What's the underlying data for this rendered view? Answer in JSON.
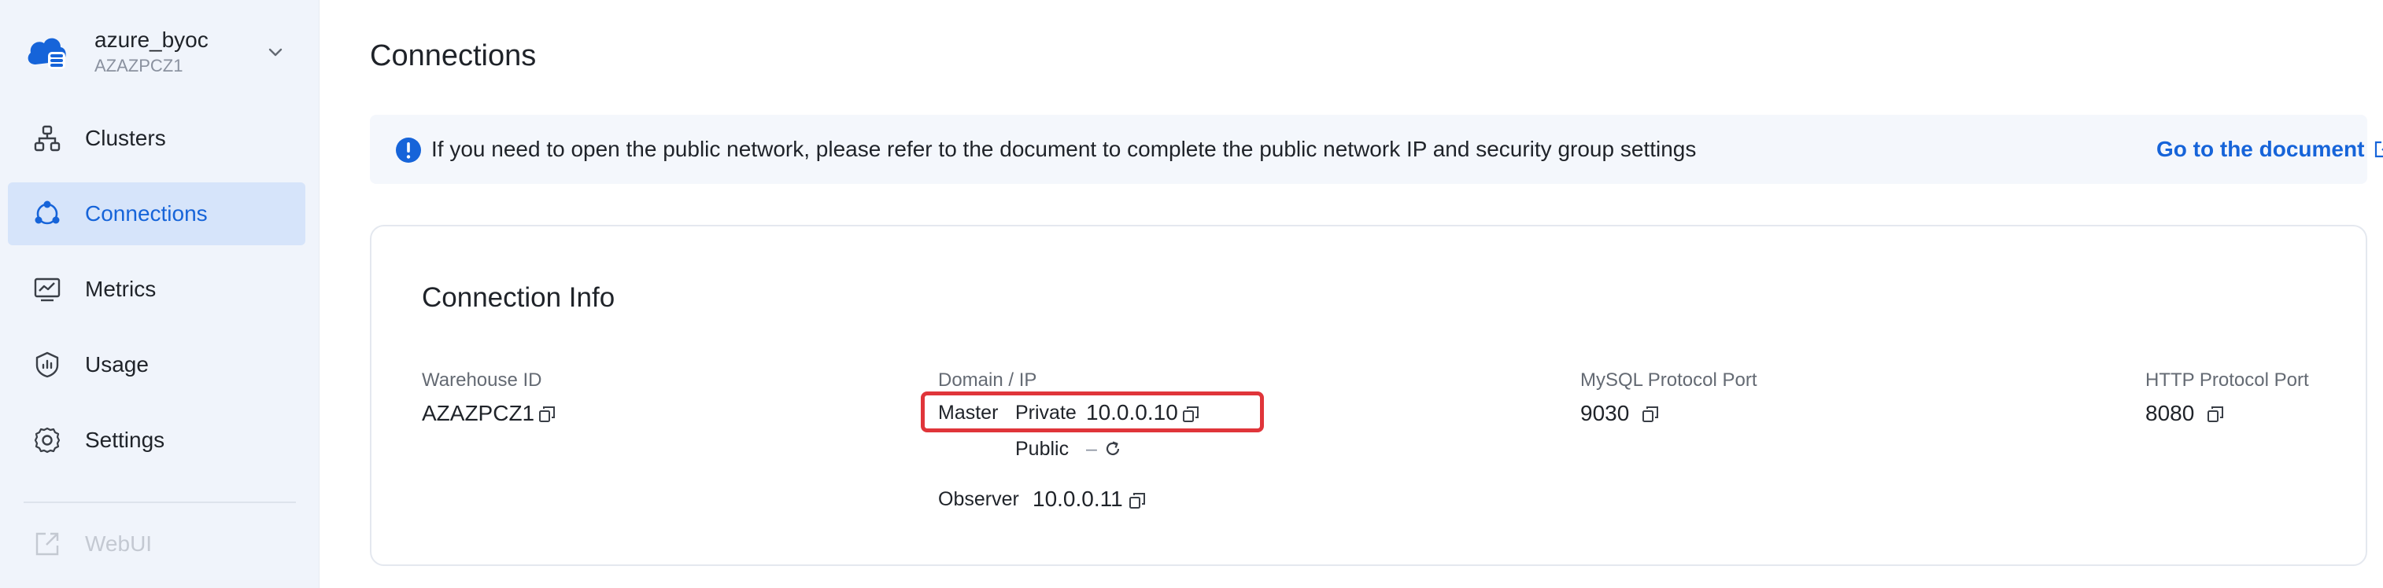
{
  "workspace": {
    "name": "azure_byoc",
    "id": "AZAZPCZ1"
  },
  "sidebar": {
    "items": [
      {
        "label": "Clusters",
        "icon": "clusters-icon"
      },
      {
        "label": "Connections",
        "icon": "connections-icon",
        "active": true
      },
      {
        "label": "Metrics",
        "icon": "metrics-icon"
      },
      {
        "label": "Usage",
        "icon": "usage-icon"
      },
      {
        "label": "Settings",
        "icon": "settings-icon"
      },
      {
        "label": "WebUI",
        "icon": "external-link-icon",
        "disabled": true
      }
    ]
  },
  "page": {
    "title": "Connections"
  },
  "banner": {
    "message": "If you need to open the public network, please refer to the document to complete the public network IP and security group settings",
    "link": "Go to the document"
  },
  "connection_info": {
    "title": "Connection Info",
    "warehouse_id_label": "Warehouse ID",
    "warehouse_id": "AZAZPCZ1",
    "domain_label": "Domain / IP",
    "master_label": "Master",
    "private_label": "Private",
    "private_ip": "10.0.0.10",
    "public_label": "Public",
    "public_value": "–",
    "observer_label": "Observer",
    "observer_ip": "10.0.0.11",
    "mysql_port_label": "MySQL Protocol Port",
    "mysql_port": "9030",
    "http_port_label": "HTTP Protocol Port",
    "http_port": "8080"
  },
  "colors": {
    "accent": "#1664d9",
    "highlight": "#e0353a",
    "sidebar_bg": "#f0f4fb"
  }
}
